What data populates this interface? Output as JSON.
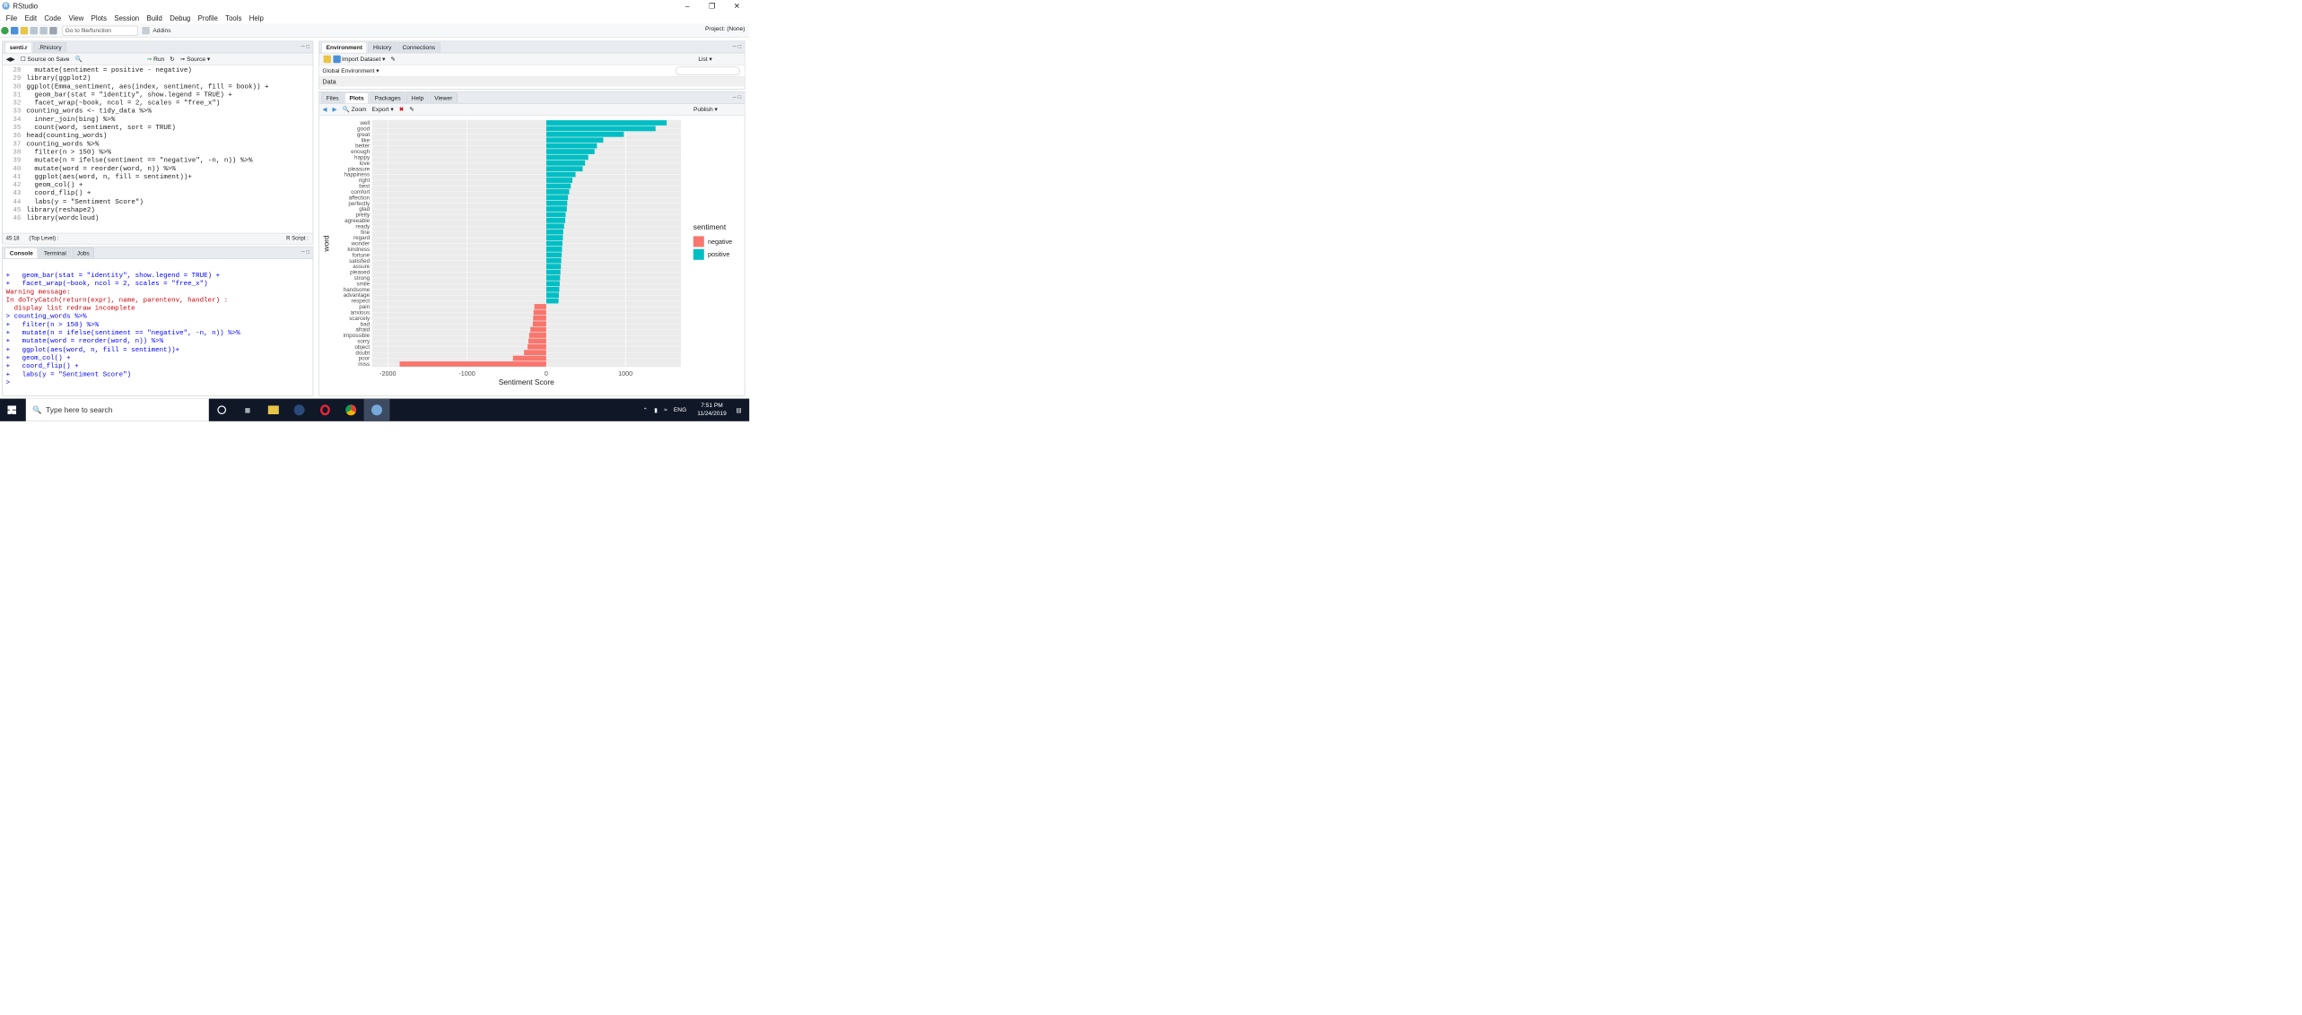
{
  "window": {
    "title": "RStudio",
    "app_icon": "R"
  },
  "menu": [
    "File",
    "Edit",
    "Code",
    "View",
    "Plots",
    "Session",
    "Build",
    "Debug",
    "Profile",
    "Tools",
    "Help"
  ],
  "toolbar": {
    "goto_placeholder": "Go to file/function",
    "addins": "Addins",
    "project": "Project: (None)"
  },
  "editor": {
    "tabs": [
      "senti.r",
      ".Rhistory"
    ],
    "source_on_save": "Source on Save",
    "run": "Run",
    "source": "Source",
    "lines": [
      {
        "n": "28",
        "t": "  mutate(sentiment = positive - negative)"
      },
      {
        "n": "29",
        "t": "library(ggplot2)"
      },
      {
        "n": "30",
        "t": "ggplot(Emma_sentiment, aes(index, sentiment, fill = book)) +"
      },
      {
        "n": "31",
        "t": "  geom_bar(stat = \"identity\", show.legend = TRUE) +"
      },
      {
        "n": "32",
        "t": "  facet_wrap(~book, ncol = 2, scales = \"free_x\")"
      },
      {
        "n": "33",
        "t": "counting_words <- tidy_data %>%"
      },
      {
        "n": "34",
        "t": "  inner_join(bing) %>%"
      },
      {
        "n": "35",
        "t": "  count(word, sentiment, sort = TRUE)"
      },
      {
        "n": "36",
        "t": "head(counting_words)"
      },
      {
        "n": "37",
        "t": "counting_words %>%"
      },
      {
        "n": "38",
        "t": "  filter(n > 150) %>%"
      },
      {
        "n": "39",
        "t": "  mutate(n = ifelse(sentiment == \"negative\", -n, n)) %>%"
      },
      {
        "n": "40",
        "t": "  mutate(word = reorder(word, n)) %>%"
      },
      {
        "n": "41",
        "t": "  ggplot(aes(word, n, fill = sentiment))+"
      },
      {
        "n": "42",
        "t": "  geom_col() +"
      },
      {
        "n": "43",
        "t": "  coord_flip() +"
      },
      {
        "n": "44",
        "t": "  labs(y = \"Sentiment Score\")"
      },
      {
        "n": "45",
        "t": "library(reshape2)"
      },
      {
        "n": "46",
        "t": "library(wordcloud)"
      }
    ],
    "status_pos": "45:18",
    "status_level": "(Top Level) :",
    "status_type": "R Script :"
  },
  "console": {
    "tabs": [
      "Console",
      "Terminal",
      "Jobs"
    ],
    "lines": [
      {
        "c": "",
        "t": "+   geom_bar(stat = \"identity\", show.legend = TRUE) +"
      },
      {
        "c": "",
        "t": "+   facet_wrap(~book, ncol = 2, scales = \"free_x\")"
      },
      {
        "c": "err",
        "t": "Warning message:"
      },
      {
        "c": "err",
        "t": "In doTryCatch(return(expr), name, parentenv, handler) :"
      },
      {
        "c": "err",
        "t": "  display list redraw incomplete"
      },
      {
        "c": "",
        "t": "> counting_words %>%"
      },
      {
        "c": "",
        "t": "+   filter(n > 150) %>%"
      },
      {
        "c": "",
        "t": "+   mutate(n = ifelse(sentiment == \"negative\", -n, n)) %>%"
      },
      {
        "c": "",
        "t": "+   mutate(word = reorder(word, n)) %>%"
      },
      {
        "c": "",
        "t": "+   ggplot(aes(word, n, fill = sentiment))+"
      },
      {
        "c": "",
        "t": "+   geom_col() +"
      },
      {
        "c": "",
        "t": "+   coord_flip() +"
      },
      {
        "c": "",
        "t": "+   labs(y = \"Sentiment Score\")"
      },
      {
        "c": "",
        "t": "> "
      }
    ]
  },
  "env": {
    "tabs": [
      "Environment",
      "History",
      "Connections"
    ],
    "import": "Import Dataset",
    "list": "List",
    "global": "Global Environment",
    "data_label": "Data"
  },
  "plots": {
    "tabs": [
      "Files",
      "Plots",
      "Packages",
      "Help",
      "Viewer"
    ],
    "zoom": "Zoom",
    "export": "Export",
    "publish": "Publish"
  },
  "chart_data": {
    "type": "bar",
    "orientation": "horizontal",
    "xlabel": "word",
    "ylabel": "Sentiment Score",
    "ylim": [
      -2200,
      1700
    ],
    "ticks": [
      -2000,
      -1000,
      0,
      1000
    ],
    "tick_labels": [
      "-2000",
      "-1000",
      "0",
      "1000"
    ],
    "legend_title": "sentiment",
    "legend_position": "right",
    "series": [
      {
        "name": "negative",
        "color": "#F8766D"
      },
      {
        "name": "positive",
        "color": "#00BFC4"
      }
    ],
    "categories": [
      "well",
      "good",
      "great",
      "like",
      "better",
      "enough",
      "happy",
      "love",
      "pleasure",
      "happiness",
      "right",
      "best",
      "comfort",
      "affection",
      "perfectly",
      "glad",
      "pretty",
      "agreeable",
      "ready",
      "fine",
      "regard",
      "wonder",
      "kindness",
      "fortune",
      "satisfied",
      "assure",
      "pleased",
      "strong",
      "smile",
      "handsome",
      "advantage",
      "respect",
      "pain",
      "anxious",
      "scarcely",
      "bad",
      "afraid",
      "impossible",
      "sorry",
      "object",
      "doubt",
      "poor",
      "miss"
    ],
    "values": [
      1520,
      1380,
      980,
      720,
      640,
      610,
      530,
      490,
      460,
      370,
      330,
      310,
      290,
      275,
      265,
      260,
      245,
      240,
      225,
      215,
      210,
      205,
      200,
      195,
      190,
      185,
      180,
      175,
      170,
      165,
      160,
      155,
      -150,
      -160,
      -165,
      -170,
      -200,
      -215,
      -225,
      -235,
      -280,
      -420,
      -1850
    ],
    "sentiment": [
      "positive",
      "positive",
      "positive",
      "positive",
      "positive",
      "positive",
      "positive",
      "positive",
      "positive",
      "positive",
      "positive",
      "positive",
      "positive",
      "positive",
      "positive",
      "positive",
      "positive",
      "positive",
      "positive",
      "positive",
      "positive",
      "positive",
      "positive",
      "positive",
      "positive",
      "positive",
      "positive",
      "positive",
      "positive",
      "positive",
      "positive",
      "positive",
      "negative",
      "negative",
      "negative",
      "negative",
      "negative",
      "negative",
      "negative",
      "negative",
      "negative",
      "negative",
      "negative"
    ]
  },
  "taskbar": {
    "search": "Type here to search",
    "lang": "ENG",
    "time": "7:51 PM",
    "date": "11/24/2019"
  }
}
